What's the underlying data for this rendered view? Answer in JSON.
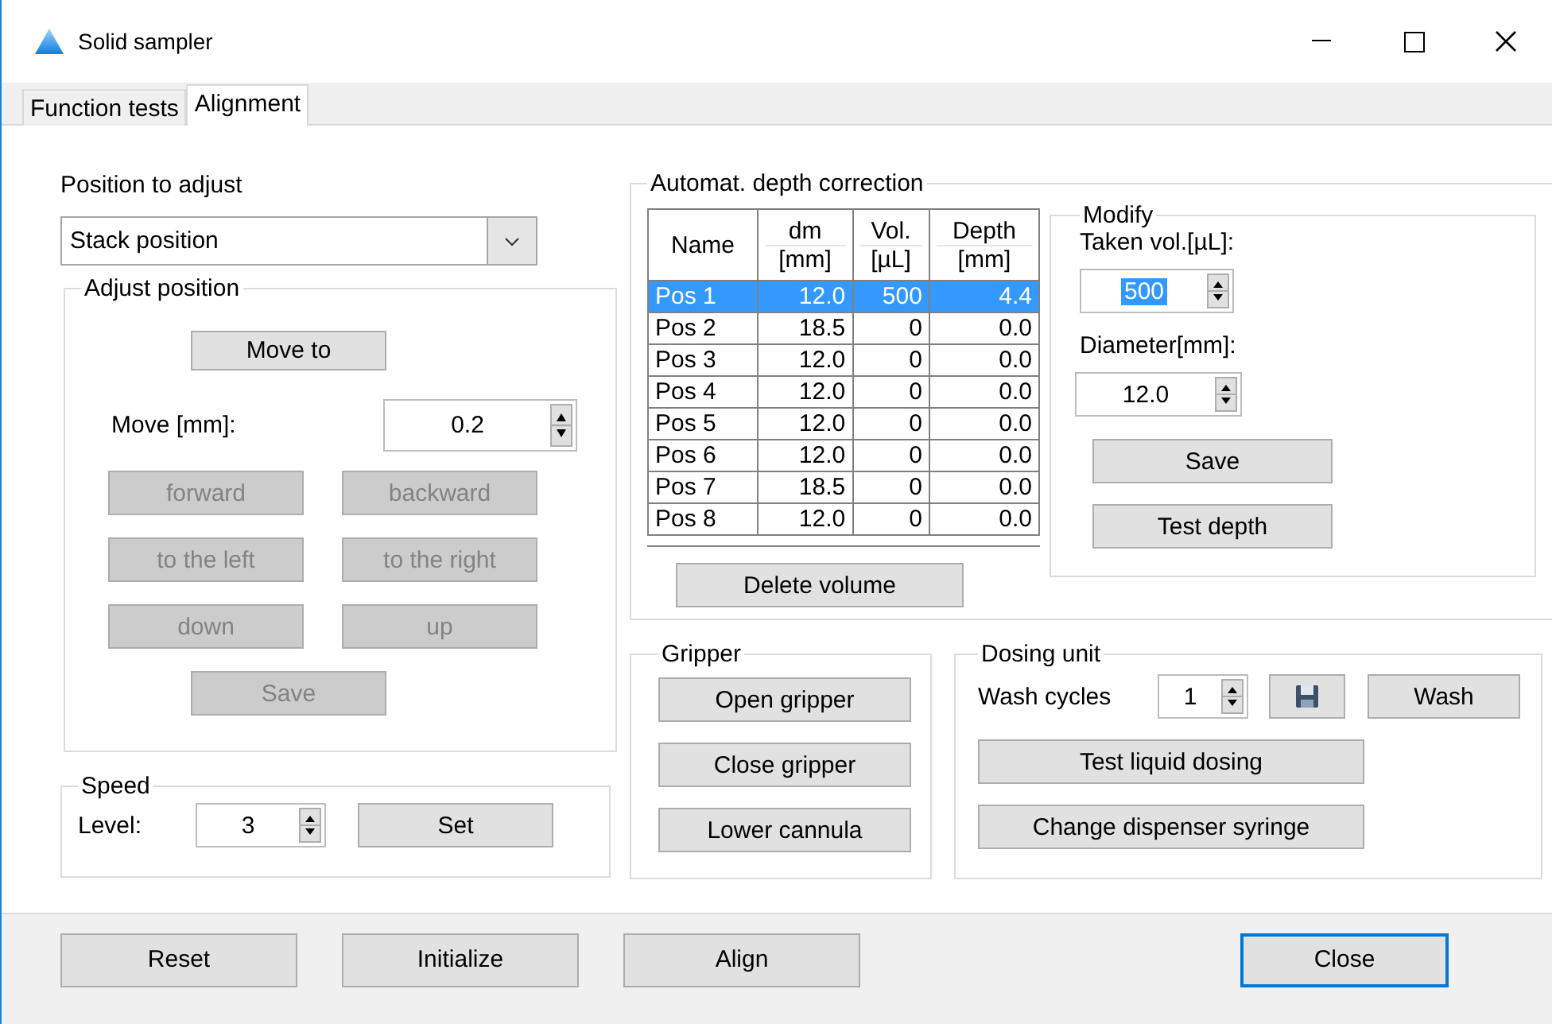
{
  "window": {
    "title": "Solid sampler"
  },
  "tabs": [
    {
      "label": "Function tests",
      "selected": false
    },
    {
      "label": "Alignment",
      "selected": true
    }
  ],
  "position_to_adjust": {
    "label": "Position to adjust",
    "value": "Stack position"
  },
  "adjust_position": {
    "title": "Adjust position",
    "move_to": "Move to",
    "move_label": "Move [mm]:",
    "move_value": "0.2",
    "direction_buttons": [
      {
        "label": "forward",
        "disabled": true
      },
      {
        "label": "backward",
        "disabled": true
      },
      {
        "label": "to the left",
        "disabled": true
      },
      {
        "label": "to the right",
        "disabled": true
      },
      {
        "label": "down",
        "disabled": true
      },
      {
        "label": "up",
        "disabled": true
      }
    ],
    "save": {
      "label": "Save",
      "disabled": true
    }
  },
  "speed": {
    "title": "Speed",
    "level_label": "Level:",
    "value": "3",
    "set_button": "Set"
  },
  "depth_correction": {
    "title": "Automat. depth correction",
    "columns": [
      {
        "lines": [
          "Name"
        ]
      },
      {
        "lines": [
          "dm",
          "[mm]"
        ]
      },
      {
        "lines": [
          "Vol.",
          "[µL]"
        ]
      },
      {
        "lines": [
          "Depth",
          "[mm]"
        ]
      }
    ],
    "rows": [
      {
        "cells": [
          "Pos 1",
          "12.0",
          "500",
          "4.4"
        ],
        "selected": true
      },
      {
        "cells": [
          "Pos 2",
          "18.5",
          "0",
          "0.0"
        ],
        "selected": false
      },
      {
        "cells": [
          "Pos 3",
          "12.0",
          "0",
          "0.0"
        ],
        "selected": false
      },
      {
        "cells": [
          "Pos 4",
          "12.0",
          "0",
          "0.0"
        ],
        "selected": false
      },
      {
        "cells": [
          "Pos 5",
          "12.0",
          "0",
          "0.0"
        ],
        "selected": false
      },
      {
        "cells": [
          "Pos 6",
          "12.0",
          "0",
          "0.0"
        ],
        "selected": false
      },
      {
        "cells": [
          "Pos 7",
          "18.5",
          "0",
          "0.0"
        ],
        "selected": false
      },
      {
        "cells": [
          "Pos 8",
          "12.0",
          "0",
          "0.0"
        ],
        "selected": false
      }
    ],
    "delete_button": "Delete volume"
  },
  "modify": {
    "title": "Modify",
    "taken_label": "Taken vol.[µL]:",
    "taken_value": "500",
    "taken_value_selected": true,
    "diameter_label": "Diameter[mm]:",
    "diameter_value": "12.0",
    "buttons": [
      "Save",
      "Test depth"
    ]
  },
  "gripper": {
    "title": "Gripper",
    "buttons": [
      "Open gripper",
      "Close gripper",
      "Lower cannula"
    ]
  },
  "dosing_unit": {
    "title": "Dosing unit",
    "wash_label": "Wash cycles",
    "wash_value": "1",
    "wash_button": "Wash",
    "buttons": [
      "Test liquid dosing",
      "Change dispenser syringe"
    ]
  },
  "footer_buttons": [
    {
      "label": "Reset",
      "focused": false
    },
    {
      "label": "Initialize",
      "focused": false
    },
    {
      "label": "Align",
      "focused": false
    },
    {
      "label": "Close",
      "focused": true
    }
  ]
}
